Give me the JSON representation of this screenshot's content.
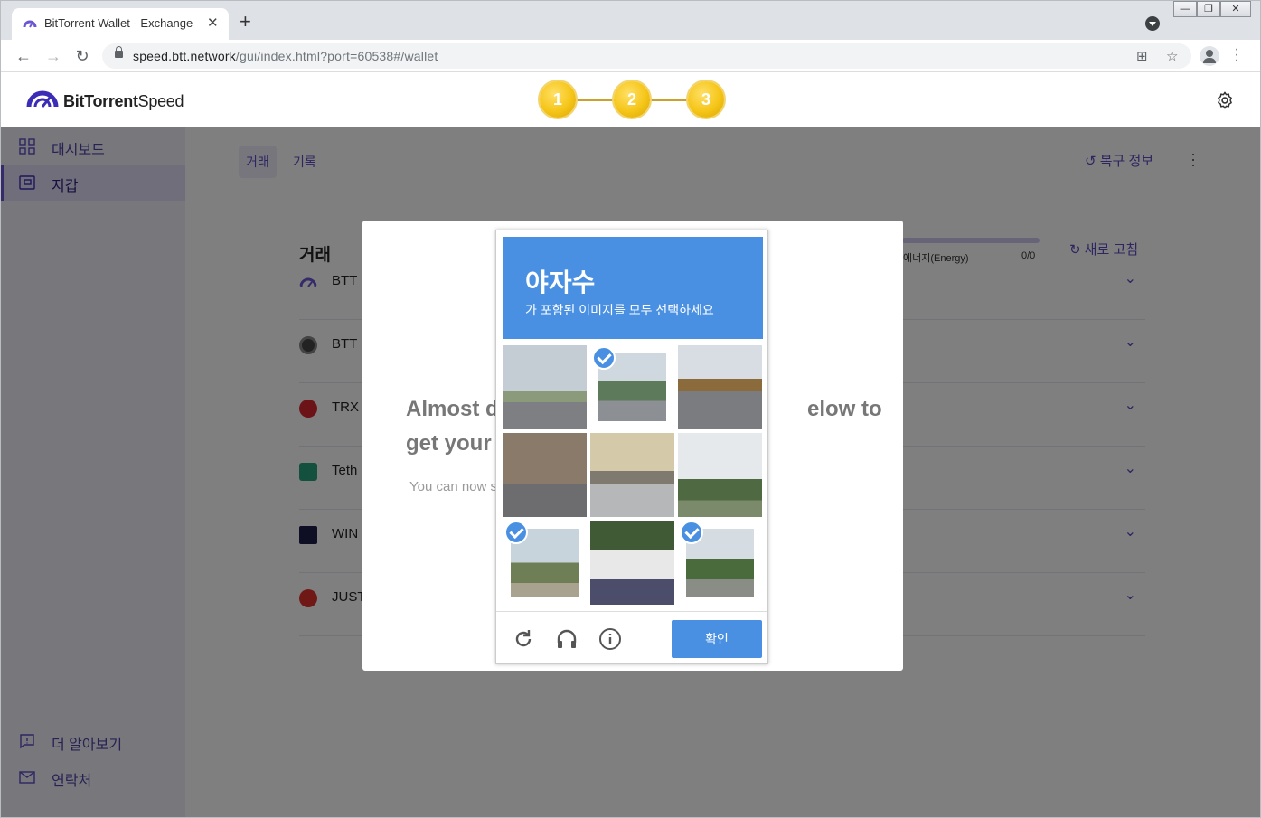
{
  "browser": {
    "tab_title": "BitTorrent Wallet - Exchange",
    "tab_close": "✕",
    "new_tab": "+",
    "url_host": "speed.btt.network",
    "url_path": "/gui/index.html?port=60538#/wallet",
    "window_controls": [
      "—",
      "❐",
      "✕"
    ]
  },
  "header": {
    "logo_bold": "BitTorrent",
    "logo_light": "Speed",
    "steps": [
      "1",
      "2",
      "3"
    ]
  },
  "sidebar": {
    "items": [
      {
        "label": "대시보드",
        "icon": "dashboard-icon"
      },
      {
        "label": "지갑",
        "icon": "wallet-icon"
      }
    ],
    "bottom": [
      {
        "label": "더 알아보기",
        "icon": "info-icon"
      },
      {
        "label": "연락처",
        "icon": "mail-icon"
      }
    ]
  },
  "main": {
    "tabs": [
      "거래",
      "기록"
    ],
    "restore_label": "복구 정보",
    "section_title": "거래",
    "energy_label": "에너지(Energy)",
    "energy_value": "0/0",
    "refresh_label": "새로 고침",
    "rows": [
      {
        "label": "BTT",
        "icon": "bittorrent-speed-icon"
      },
      {
        "label": "BTT",
        "icon": "btt-coin-icon"
      },
      {
        "label": "TRX",
        "icon": "tron-icon"
      },
      {
        "label": "Teth",
        "icon": "tether-icon"
      },
      {
        "label": "WIN",
        "icon": "wink-icon"
      },
      {
        "label": "JUST",
        "icon": "just-icon"
      }
    ]
  },
  "dialog": {
    "title_left_1": "Almost d",
    "title_right_1": "elow to",
    "title_left_2": "get your",
    "subtitle": "You can now s"
  },
  "captcha": {
    "keyword": "야자수",
    "instruction": "가 포함된 이미지를 모두 선택하세요",
    "verify_label": "확인",
    "accent": "#4a90e2",
    "tiles": [
      {
        "scene": "street-traffic-light",
        "selected": false
      },
      {
        "scene": "palm-tree-bridge",
        "selected": true
      },
      {
        "scene": "road-cars",
        "selected": false
      },
      {
        "scene": "sidewalk-bicycle",
        "selected": false
      },
      {
        "scene": "parking-truck",
        "selected": false
      },
      {
        "scene": "park-pole",
        "selected": false
      },
      {
        "scene": "palm-tree-wires",
        "selected": true
      },
      {
        "scene": "white-fence",
        "selected": false
      },
      {
        "scene": "palm-trees-field",
        "selected": true
      }
    ]
  }
}
